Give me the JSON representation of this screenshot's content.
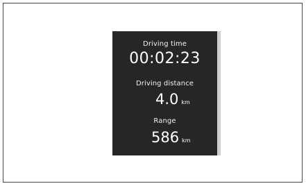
{
  "trip_display": {
    "driving_time": {
      "label": "Driving time",
      "value": "00:02:23"
    },
    "driving_distance": {
      "label": "Driving distance",
      "value": "4.0",
      "unit": "km"
    },
    "range": {
      "label": "Range",
      "value": "586",
      "unit": "km"
    }
  },
  "colors": {
    "display_background": "#262626",
    "display_text": "#ffffff",
    "display_edge": "#cfcfcf",
    "frame_border": "#444444"
  }
}
